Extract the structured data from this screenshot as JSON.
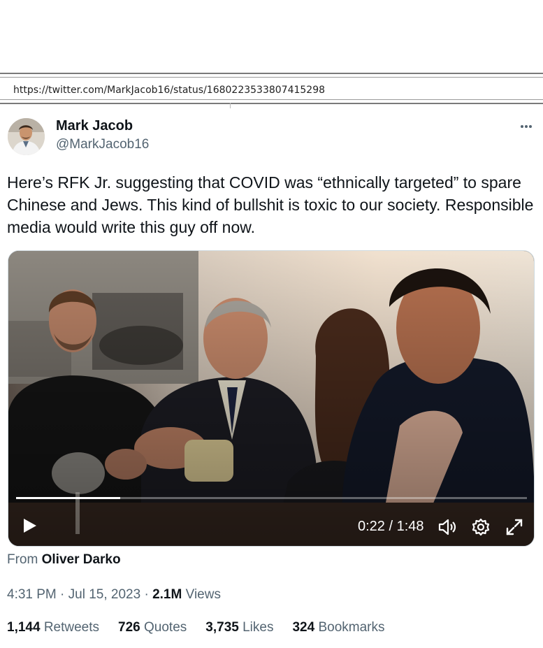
{
  "browser": {
    "url": "https://twitter.com/MarkJacob16/status/1680223533807415298"
  },
  "tweet": {
    "author_name": "Mark Jacob",
    "author_handle": "@MarkJacob16",
    "text": "Here’s RFK Jr. suggesting that COVID was “ethnically targeted” to spare Chinese and Jews. This kind of bullshit is toxic to our society. Responsible media would write this guy off now.",
    "video": {
      "current_time": "0:22",
      "separator": "/",
      "duration": "1:48",
      "progress": 0.2037
    },
    "source_prefix": "From",
    "source_name": "Oliver Darko",
    "time": "4:31 PM",
    "date": "Jul 15, 2023",
    "dot": "·",
    "views_count": "2.1M",
    "views_label": "Views",
    "stats": {
      "retweets_count": "1,144",
      "retweets_label": "Retweets",
      "quotes_count": "726",
      "quotes_label": "Quotes",
      "likes_count": "3,735",
      "likes_label": "Likes",
      "bookmarks_count": "324",
      "bookmarks_label": "Bookmarks"
    }
  },
  "colors": {
    "text_primary": "#0f1419",
    "text_secondary": "#536471",
    "border": "#cfd9de"
  },
  "icons": [
    "more-icon",
    "play-icon",
    "volume-icon",
    "settings-icon",
    "fullscreen-icon"
  ]
}
